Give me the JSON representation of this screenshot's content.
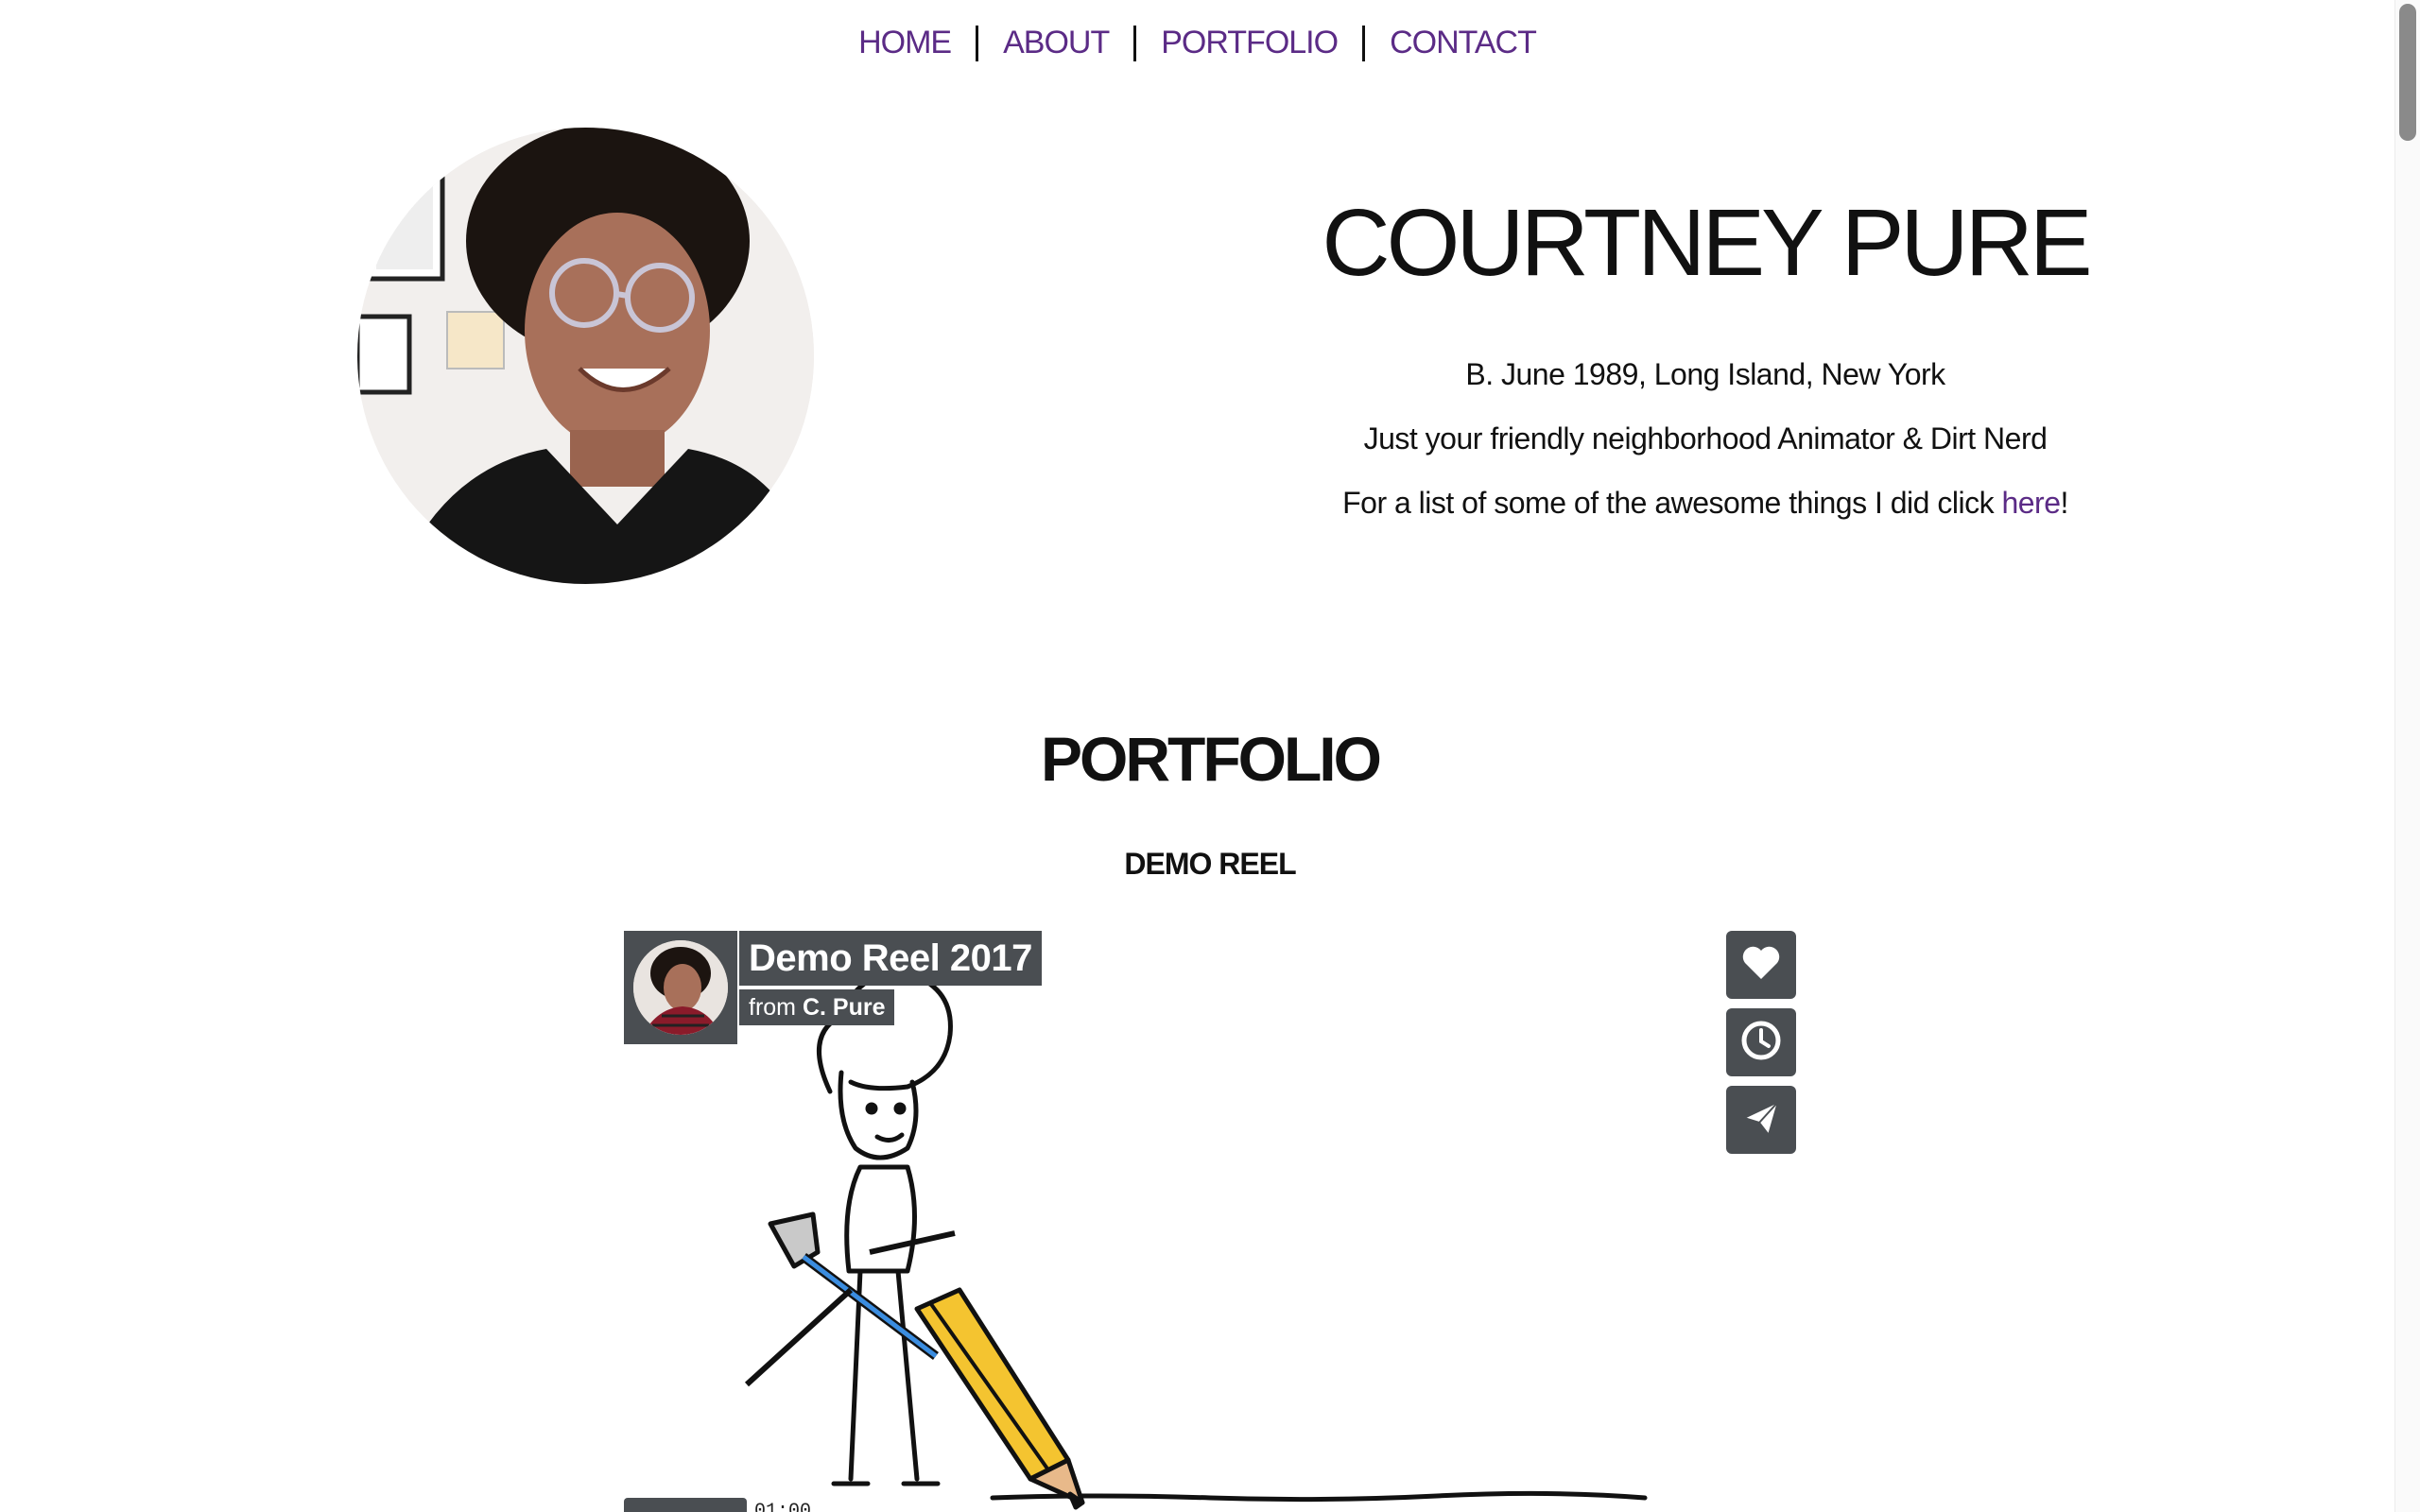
{
  "nav": {
    "items": [
      {
        "label": "HOME"
      },
      {
        "label": "ABOUT"
      },
      {
        "label": "PORTFOLIO"
      },
      {
        "label": "CONTACT"
      }
    ]
  },
  "hero": {
    "name": "COURTNEY PURE",
    "birth": "B. June 1989, Long Island, New York",
    "tagline": "Just your friendly neighborhood Animator & Dirt Nerd",
    "list_prefix": "For a list of some of the awesome things I did click ",
    "list_link": "here",
    "list_suffix": "!"
  },
  "portfolio": {
    "title": "PORTFOLIO",
    "subtitle": "DEMO REEL"
  },
  "video": {
    "title": "Demo Reel 2017",
    "from_prefix": "from",
    "author": "C. Pure",
    "duration": "01:00",
    "actions": [
      "heart-icon",
      "clock-icon",
      "send-icon"
    ]
  },
  "colors": {
    "link": "#5b2b86",
    "video_overlay": "#4a4e52"
  }
}
